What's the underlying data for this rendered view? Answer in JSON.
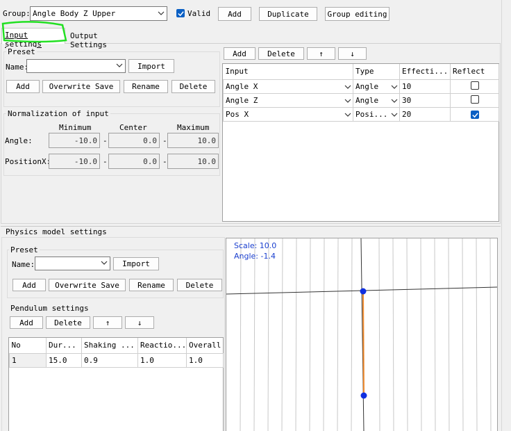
{
  "toolbar": {
    "group_label": "Group:",
    "group_value": "Angle Body Z Upper",
    "valid_label": "Valid",
    "valid_checked": true,
    "add_label": "Add",
    "duplicate_label": "Duplicate",
    "group_editing_label": "Group editing"
  },
  "tabs": [
    {
      "label": "Input settings",
      "active": true
    },
    {
      "label": "Output Settings",
      "active": false
    }
  ],
  "input_preset": {
    "title": "Preset",
    "name_label": "Name:",
    "name_value": "",
    "import_label": "Import",
    "add_label": "Add",
    "overwrite_label": "Overwrite Save",
    "rename_label": "Rename",
    "delete_label": "Delete"
  },
  "normalization": {
    "title": "Normalization of input",
    "col_min": "Minimum",
    "col_center": "Center",
    "col_max": "Maximum",
    "rows": [
      {
        "label": "Angle:",
        "min": "-10.0",
        "center": "0.0",
        "max": "10.0"
      },
      {
        "label": "PositionX:",
        "min": "-10.0",
        "center": "0.0",
        "max": "10.0"
      }
    ]
  },
  "inputs": {
    "add_label": "Add",
    "delete_label": "Delete",
    "up_label": "↑",
    "down_label": "↓",
    "headers": [
      "Input",
      "Type",
      "Effecti...",
      "Reflect"
    ],
    "rows": [
      {
        "input": "Angle X",
        "type": "Angle",
        "effect": "10",
        "reflect": false
      },
      {
        "input": "Angle Z",
        "type": "Angle",
        "effect": "30",
        "reflect": false
      },
      {
        "input": "Pos X",
        "type": "Posi...",
        "effect": "20",
        "reflect": true
      }
    ]
  },
  "physics": {
    "title": "Physics model settings",
    "preset_title": "Preset",
    "name_label": "Name:",
    "name_value": "",
    "import_label": "Import",
    "add_label": "Add",
    "overwrite_label": "Overwrite Save",
    "rename_label": "Rename",
    "delete_label": "Delete",
    "pendulum_title": "Pendulum settings",
    "p_add_label": "Add",
    "p_delete_label": "Delete",
    "p_up_label": "↑",
    "p_down_label": "↓",
    "headers": [
      "No",
      "Dur...",
      "Shaking ...",
      "Reactio...",
      "Overall"
    ],
    "rows": [
      {
        "no": "1",
        "dur": "15.0",
        "shaking": "0.9",
        "reaction": "1.0",
        "overall": "1.0"
      }
    ]
  },
  "preview": {
    "scale_text": "Scale: 10.0",
    "angle_text": "Angle: -1.4",
    "text_color": "#1a3fcf",
    "pendulum_color": "#f08a2c",
    "node_color": "#1030e0"
  },
  "colors": {
    "accent": "#0a5fc4",
    "highlight": "#22e022"
  }
}
